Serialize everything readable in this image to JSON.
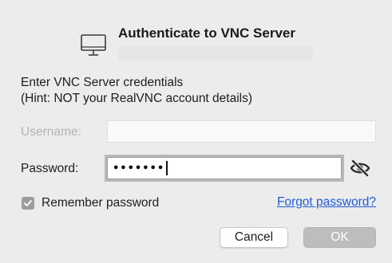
{
  "dialog": {
    "title": "Authenticate to VNC Server",
    "prompt_line1": "Enter VNC Server credentials",
    "prompt_line2": "(Hint: NOT your RealVNC account details)"
  },
  "username": {
    "label": "Username:",
    "value": ""
  },
  "password": {
    "label": "Password:",
    "masked_value": "•••••••"
  },
  "remember": {
    "label": "Remember password",
    "checked": true
  },
  "links": {
    "forgot": "Forgot password?"
  },
  "buttons": {
    "cancel": "Cancel",
    "ok": "OK"
  },
  "icons": {
    "header": "monitor-icon",
    "reveal_password": "eye-slash-icon",
    "checkbox": "checkmark-icon"
  },
  "colors": {
    "background": "#ececec",
    "link": "#1f5bd6",
    "ok_button": "#bdbdbd",
    "checkbox": "#9d9d9d"
  }
}
